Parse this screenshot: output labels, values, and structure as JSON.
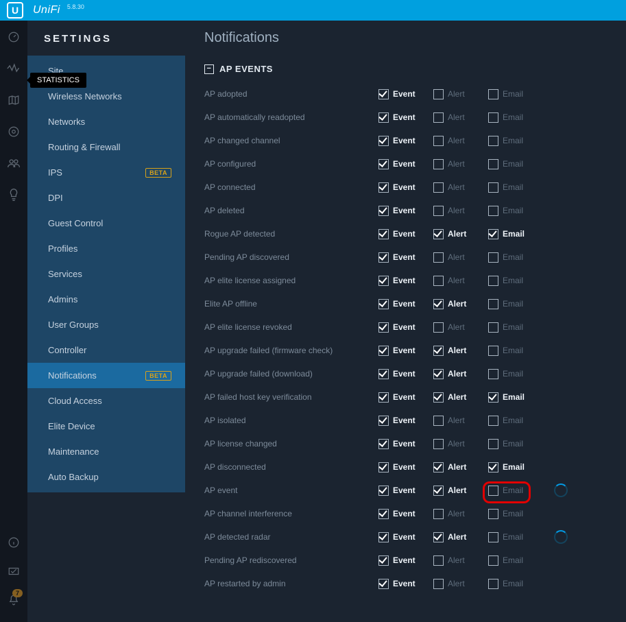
{
  "header": {
    "brand": "UniFi",
    "version": "5.8.30"
  },
  "tooltip": "STATISTICS",
  "settings_title": "SETTINGS",
  "sidebar_icons": [
    {
      "name": "dashboard-icon"
    },
    {
      "name": "statistics-icon"
    },
    {
      "name": "map-icon"
    },
    {
      "name": "devices-icon"
    },
    {
      "name": "clients-icon"
    },
    {
      "name": "insights-icon"
    }
  ],
  "sidebar_bottom_icons": [
    {
      "name": "info-icon"
    },
    {
      "name": "ack-icon"
    },
    {
      "name": "alerts-icon",
      "badge": "7"
    }
  ],
  "nav": [
    {
      "label": "Site"
    },
    {
      "label": "Wireless Networks"
    },
    {
      "label": "Networks"
    },
    {
      "label": "Routing & Firewall"
    },
    {
      "label": "IPS",
      "badge": "BETA"
    },
    {
      "label": "DPI"
    },
    {
      "label": "Guest Control"
    },
    {
      "label": "Profiles"
    },
    {
      "label": "Services"
    },
    {
      "label": "Admins"
    },
    {
      "label": "User Groups"
    },
    {
      "label": "Controller"
    },
    {
      "label": "Notifications",
      "badge": "BETA",
      "active": true
    },
    {
      "label": "Cloud Access"
    },
    {
      "label": "Elite Device"
    },
    {
      "label": "Maintenance"
    },
    {
      "label": "Auto Backup"
    }
  ],
  "page": {
    "title": "Notifications",
    "section": "AP EVENTS"
  },
  "col_labels": {
    "event": "Event",
    "alert": "Alert",
    "email": "Email"
  },
  "rows": [
    {
      "label": "AP adopted",
      "event": true,
      "alert": false,
      "email": false
    },
    {
      "label": "AP automatically readopted",
      "event": true,
      "alert": false,
      "email": false
    },
    {
      "label": "AP changed channel",
      "event": true,
      "alert": false,
      "email": false
    },
    {
      "label": "AP configured",
      "event": true,
      "alert": false,
      "email": false
    },
    {
      "label": "AP connected",
      "event": true,
      "alert": false,
      "email": false
    },
    {
      "label": "AP deleted",
      "event": true,
      "alert": false,
      "email": false
    },
    {
      "label": "Rogue AP detected",
      "event": true,
      "alert": true,
      "email": true
    },
    {
      "label": "Pending AP discovered",
      "event": true,
      "alert": false,
      "email": false
    },
    {
      "label": "AP elite license assigned",
      "event": true,
      "alert": false,
      "email": false
    },
    {
      "label": "Elite AP offline",
      "event": true,
      "alert": true,
      "email": false
    },
    {
      "label": "AP elite license revoked",
      "event": true,
      "alert": false,
      "email": false
    },
    {
      "label": "AP upgrade failed (firmware check)",
      "event": true,
      "alert": true,
      "email": false
    },
    {
      "label": "AP upgrade failed (download)",
      "event": true,
      "alert": true,
      "email": false
    },
    {
      "label": "AP failed host key verification",
      "event": true,
      "alert": true,
      "email": true
    },
    {
      "label": "AP isolated",
      "event": true,
      "alert": false,
      "email": false
    },
    {
      "label": "AP license changed",
      "event": true,
      "alert": false,
      "email": false
    },
    {
      "label": "AP disconnected",
      "event": true,
      "alert": true,
      "email": true
    },
    {
      "label": "AP event",
      "event": true,
      "alert": true,
      "email": false,
      "spinner": true,
      "annot": true
    },
    {
      "label": "AP channel interference",
      "event": true,
      "alert": false,
      "email": false
    },
    {
      "label": "AP detected radar",
      "event": true,
      "alert": true,
      "email": false,
      "spinner": true
    },
    {
      "label": "Pending AP rediscovered",
      "event": true,
      "alert": false,
      "email": false
    },
    {
      "label": "AP restarted by admin",
      "event": true,
      "alert": false,
      "email": false
    }
  ]
}
